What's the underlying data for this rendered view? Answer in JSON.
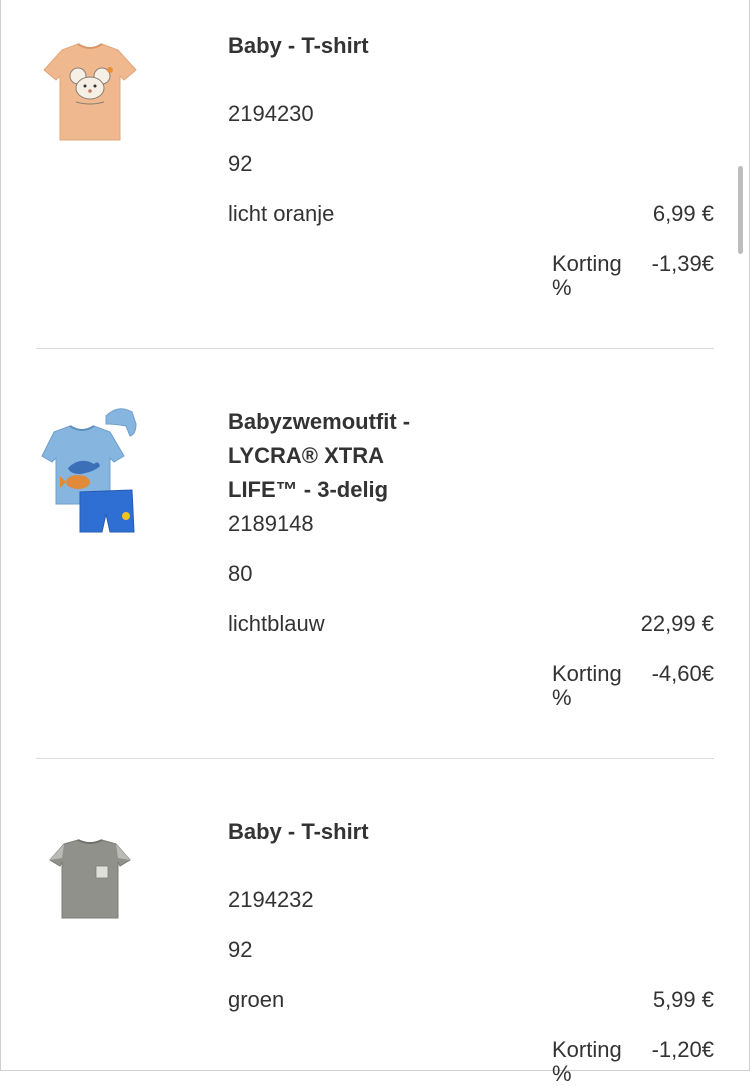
{
  "products": [
    {
      "title": "Baby - T-shirt",
      "article_number": "2194230",
      "size": "92",
      "color": "licht oranje",
      "price": "6,99 €",
      "discount_label": "Korting %",
      "discount_value": "-1,39€",
      "image_icon": "tshirt-orange-mouse-icon"
    },
    {
      "title": "Babyzwemoutfit - LYCRA® XTRA LIFE™ - 3-delig",
      "article_number": "2189148",
      "size": "80",
      "color": "lichtblauw",
      "price": "22,99 €",
      "discount_label": "Korting %",
      "discount_value": "-4,60€",
      "image_icon": "swim-outfit-icon"
    },
    {
      "title": "Baby - T-shirt",
      "article_number": "2194232",
      "size": "92",
      "color": "groen",
      "price": "5,99 €",
      "discount_label": "Korting %",
      "discount_value": "-1,20€",
      "image_icon": "tshirt-green-icon"
    }
  ],
  "colors": {
    "text": "#333333",
    "divider": "#dcdcdc",
    "orange_shirt": "#efb88e",
    "blue_shirt": "#86b6e0",
    "blue_shorts": "#2f6fd3",
    "green_shirt": "#8f918a"
  }
}
